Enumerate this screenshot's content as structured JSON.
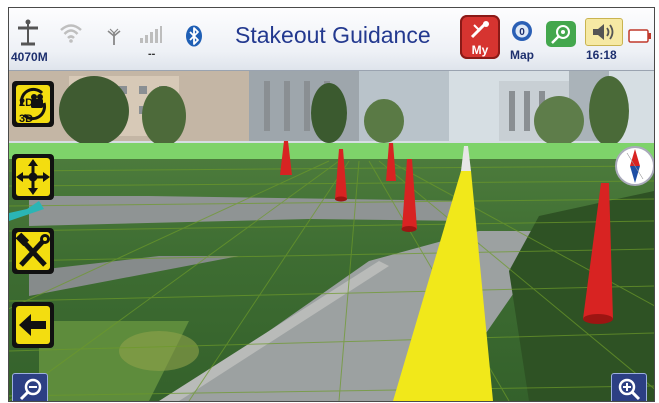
{
  "status_bar": {
    "elevation": "4070M",
    "signal_value": "--",
    "title": "Stakeout Guidance",
    "my_button_label": "My",
    "map_button_label": "Map",
    "time": "16:18"
  },
  "view_toggle": {
    "top": "2D",
    "bottom": "3D"
  },
  "icons": {
    "gps": "gnss-antenna-icon",
    "wifi": "wifi-icon",
    "radio": "radio-antenna-icon",
    "signal": "signal-bars-icon",
    "bluetooth": "bluetooth-icon",
    "my": "survey-point-icon",
    "map": "map-globe-icon",
    "target": "target-icon",
    "speaker": "speaker-icon",
    "battery": "battery-icon",
    "view": "camera-view-toggle-icon",
    "move": "move-arrows-icon",
    "tools": "tools-icon",
    "back": "back-arrow-icon",
    "zoom_out": "zoom-out-icon",
    "zoom_in": "zoom-in-icon",
    "compass": "compass-icon"
  },
  "colors": {
    "title": "#23398f",
    "my_button": "#d63430",
    "tool_accent": "#f3dd10",
    "guide_line": "#f1e81a",
    "stake_cone": "#d82322",
    "zoom_button": "#2c3f83"
  }
}
